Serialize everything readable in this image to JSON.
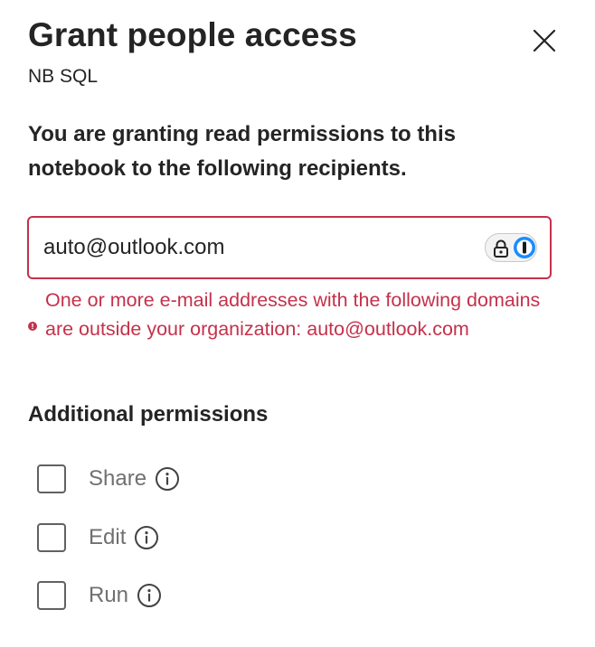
{
  "panel": {
    "title": "Grant people access",
    "subtitle": "NB SQL",
    "close_icon": "close-icon"
  },
  "intro_text": "You are granting read permissions to this notebook to the following recipients.",
  "recipients": {
    "value": "auto@outlook.com",
    "password_manager_icon": "1password-icon",
    "lock_icon": "lock-icon"
  },
  "error": {
    "icon": "error-dot-icon",
    "message": "One or more e-mail addresses with the following domains are outside your organization: auto@outlook.com"
  },
  "additional_permissions": {
    "title": "Additional permissions",
    "items": [
      {
        "label": "Share",
        "checked": false,
        "info_icon": "info-icon"
      },
      {
        "label": "Edit",
        "checked": false,
        "info_icon": "info-icon"
      },
      {
        "label": "Run",
        "checked": false,
        "info_icon": "info-icon"
      }
    ]
  },
  "colors": {
    "error": "#c4314b",
    "text": "#242424",
    "muted_label": "#707070",
    "onepassword_blue": "#1a8cff"
  }
}
